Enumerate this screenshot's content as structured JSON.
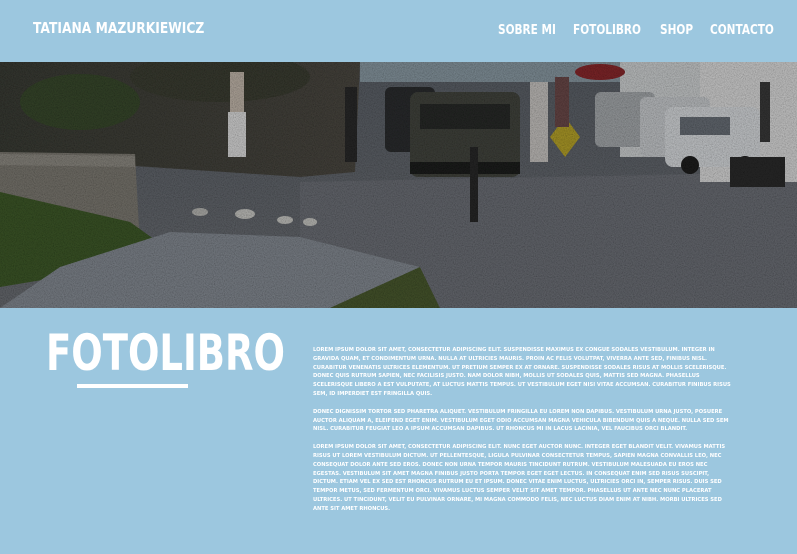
{
  "header": {
    "site_title": "TATIANA MAZURKIEWICZ",
    "nav": {
      "sobre_mi": "SOBRE MI",
      "fotolibro": "FOTOLIBRO",
      "shop": "SHOP",
      "contacto": "CONTACTO"
    }
  },
  "hero": {
    "image": "street-scene-photo"
  },
  "main": {
    "title": "FOTOLIBRO",
    "paragraphs": [
      "Lorem ipsum dolor sit amet, consectetur adipiscing elit. Suspendisse maximus ex congue sodales vestibulum. Integer in gravida quam, et condimentum urna. Nulla at ultricies mauris. Proin ac felis volutpat, viverra ante sed, finibus nisl. Curabitur venenatis ultrices elementum. Ut pretium semper ex at ornare. Suspendisse sodales risus at mollis scelerisque. Donec quis rutrum sapien, nec facilisis justo. Nam dolor nibh, mollis ut sodales quis, mattis sed magna. Phasellus scelerisque libero a est vulputate, at luctus mattis tempus. Ut vestibulum eget nisi vitae accumsan. Curabitur finibus risus sem, id imperdiet est fringilla quis.",
      "Donec dignissim tortor sed pharetra aliquet. Vestibulum fringilla eu lorem non dapibus. Vestibulum urna justo, posuere auctor aliquam a, eleifend eget enim. Vestibulum eget odio accumsan magna vehicula bibendum quis a neque. Nulla sed sem nisl. Curabitur feugiat leo a ipsum accumsan dapibus. Ut rhoncus mi in lacus lacinia, vel faucibus orci blandit.",
      "Lorem ipsum dolor sit amet, consectetur adipiscing elit. Nunc eget auctor nunc. Integer eget blandit velit. Vivamus mattis risus ut lorem vestibulum dictum. Ut pellentesque, ligula pulvinar consectetur tempus, sapien magna convallis leo, nec consequat dolor ante sed eros. Donec non urna tempor mauris tincidunt rutrum. Vestibulum malesuada eu eros nec egestas. Vestibulum sit amet magna finibus justo porta tempor eget eget lectus. In consequat enim sed risus suscipit, dictum. Etiam vel ex sed est rhoncus rutrum eu et ipsum. Donec vitae enim luctus, ultricies orci in, semper risus. Duis sed tempor metus, sed fermentum orci. Vivamus luctus semper velit sit amet tempor. Phasellus ut ante nec nunc placerat ultrices. Ut tincidunt, velit eu pulvinar ornare, mi magna commodo felis, nec luctus diam enim at nibh. Morbi ultrices sed ante sit amet rhoncus."
    ]
  },
  "colors": {
    "background": "#9cc7df",
    "text": "#ffffff"
  }
}
